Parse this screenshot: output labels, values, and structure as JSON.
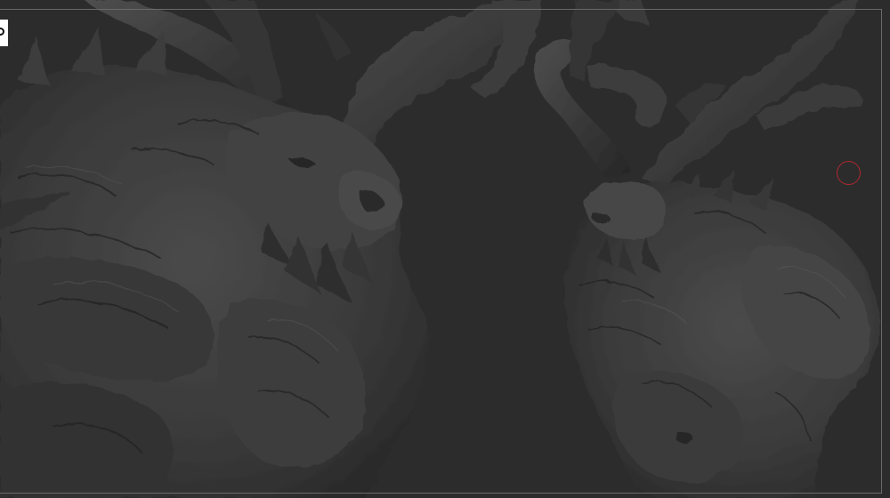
{
  "viewport": {
    "background": "#2c2c2c",
    "frame_color": "#6a6a6a",
    "material_color": "#3a3a3a"
  },
  "objects": {
    "left": "creature-bust-closeup-icon",
    "right": "creature-bust-full-icon"
  },
  "cursor": {
    "icon": "brush-circle-icon",
    "color": "#b0282c"
  },
  "corner_marker": {
    "icon": "corner-marker-icon",
    "color": "#ffffff"
  }
}
